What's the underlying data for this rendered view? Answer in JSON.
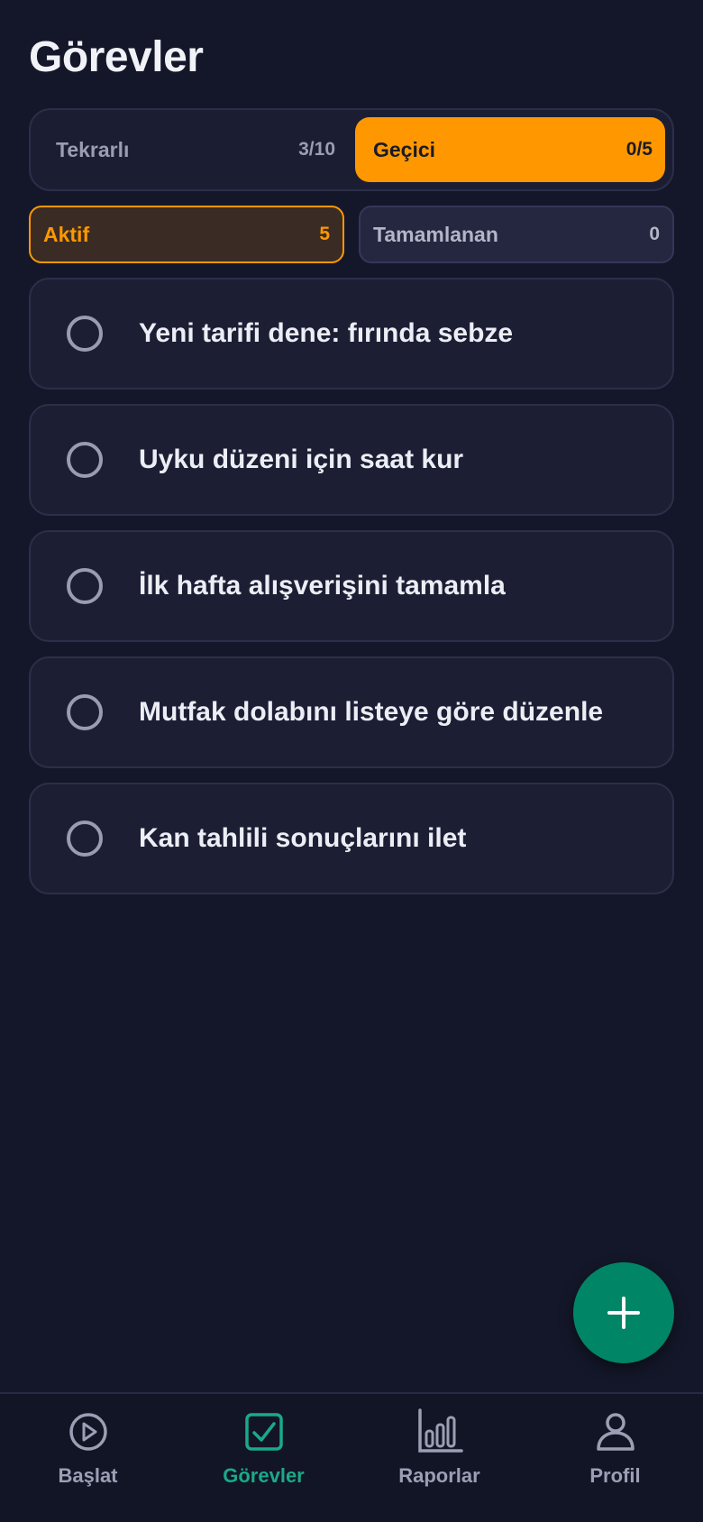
{
  "page": {
    "title": "Görevler"
  },
  "type_switch": [
    {
      "label": "Tekrarlı",
      "count": "3/10",
      "active": false
    },
    {
      "label": "Geçici",
      "count": "0/5",
      "active": true
    }
  ],
  "status_filters": [
    {
      "label": "Aktif",
      "count": "5",
      "active": true
    },
    {
      "label": "Tamamlanan",
      "count": "0",
      "active": false
    }
  ],
  "tasks": [
    {
      "text": "Yeni tarifi dene: fırında sebze",
      "done": false
    },
    {
      "text": "Uyku düzeni için saat kur",
      "done": false
    },
    {
      "text": "İlk hafta alışverişini tamamla",
      "done": false
    },
    {
      "text": "Mutfak dolabını listeye göre düzenle",
      "done": false
    },
    {
      "text": "Kan tahlili sonuçlarını ilet",
      "done": false
    }
  ],
  "fab": {
    "icon": "plus-icon"
  },
  "nav": [
    {
      "label": "Başlat",
      "icon": "play-circle-icon",
      "active": false
    },
    {
      "label": "Görevler",
      "icon": "checkbox-icon",
      "active": true
    },
    {
      "label": "Raporlar",
      "icon": "bar-chart-icon",
      "active": false
    },
    {
      "label": "Profil",
      "icon": "user-icon",
      "active": false
    }
  ],
  "colors": {
    "background": "#141729",
    "accent": "#ff9800",
    "success": "#1ba988",
    "fab": "#008566"
  }
}
